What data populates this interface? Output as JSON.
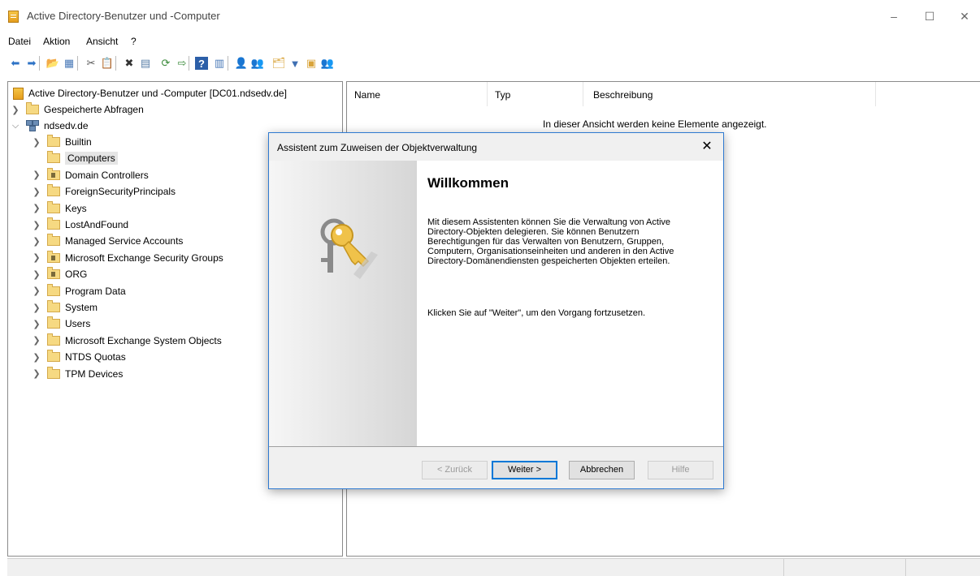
{
  "window": {
    "title": "Active Directory-Benutzer und -Computer",
    "minimize": "–",
    "maximize": "☐",
    "close": "✕"
  },
  "menu": [
    "Datei",
    "Aktion",
    "Ansicht",
    "?"
  ],
  "toolbar": [
    {
      "icon": "back-arrow-icon",
      "glyph": "⬅",
      "color": "#2e73c5"
    },
    {
      "icon": "forward-arrow-icon",
      "glyph": "➡",
      "color": "#2e73c5"
    },
    {
      "icon": "up-folder-icon",
      "glyph": "📂",
      "color": "#d9a43a"
    },
    {
      "icon": "show-console-tree-icon",
      "glyph": "▦",
      "color": "#4a7ab8"
    },
    {
      "icon": "cut-icon",
      "glyph": "✂",
      "color": "#555"
    },
    {
      "icon": "copy-icon",
      "glyph": "📋",
      "color": "#555"
    },
    {
      "icon": "delete-icon",
      "glyph": "✖",
      "color": "#333"
    },
    {
      "icon": "properties-icon",
      "glyph": "▤",
      "color": "#5a7fa8"
    },
    {
      "icon": "refresh-icon",
      "glyph": "⟳",
      "color": "#3a8a3a"
    },
    {
      "icon": "export-list-icon",
      "glyph": "⇨",
      "color": "#3a8a3a"
    },
    {
      "icon": "help-icon",
      "glyph": "?",
      "color": "#fff"
    },
    {
      "icon": "show-action-pane-icon",
      "glyph": "▥",
      "color": "#4a7ab8"
    },
    {
      "icon": "new-user-icon",
      "glyph": "👤",
      "color": "#6b8db5"
    },
    {
      "icon": "new-group-icon",
      "glyph": "👥",
      "color": "#6b8db5"
    },
    {
      "icon": "new-ou-icon",
      "glyph": "🗂",
      "color": "#d9a43a"
    },
    {
      "icon": "filter-icon",
      "glyph": "▼",
      "color": "#3f6fb2"
    },
    {
      "icon": "add-to-group-icon",
      "glyph": "▣",
      "color": "#d9a43a"
    },
    {
      "icon": "delegate-icon",
      "glyph": "👥",
      "color": "#6b8db5"
    }
  ],
  "tree": {
    "root": "Active Directory-Benutzer und -Computer [DC01.ndsedv.de]",
    "saved_queries": "Gespeicherte Abfragen",
    "domain": "ndsedv.de",
    "items": [
      {
        "label": "Builtin",
        "ou": false,
        "selected": false
      },
      {
        "label": "Computers",
        "ou": false,
        "selected": true
      },
      {
        "label": "Domain Controllers",
        "ou": true,
        "selected": false
      },
      {
        "label": "ForeignSecurityPrincipals",
        "ou": false,
        "selected": false
      },
      {
        "label": "Keys",
        "ou": false,
        "selected": false
      },
      {
        "label": "LostAndFound",
        "ou": false,
        "selected": false
      },
      {
        "label": "Managed Service Accounts",
        "ou": false,
        "selected": false
      },
      {
        "label": "Microsoft Exchange Security Groups",
        "ou": true,
        "selected": false
      },
      {
        "label": "ORG",
        "ou": true,
        "selected": false
      },
      {
        "label": "Program Data",
        "ou": false,
        "selected": false
      },
      {
        "label": "System",
        "ou": false,
        "selected": false
      },
      {
        "label": "Users",
        "ou": false,
        "selected": false
      },
      {
        "label": "Microsoft Exchange System Objects",
        "ou": false,
        "selected": false
      },
      {
        "label": "NTDS Quotas",
        "ou": false,
        "selected": false
      },
      {
        "label": "TPM Devices",
        "ou": false,
        "selected": false
      }
    ]
  },
  "list": {
    "columns": [
      "Name",
      "Typ",
      "Beschreibung"
    ],
    "empty_message": "In dieser Ansicht werden keine Elemente angezeigt."
  },
  "dialog": {
    "title": "Assistent zum Zuweisen der Objektverwaltung",
    "heading": "Willkommen",
    "text": "Mit diesem Assistenten können Sie die Verwaltung von Active Directory-Objekten delegieren. Sie können Benutzern Berechtigungen für das Verwalten von Benutzern, Gruppen, Computern, Organisationseinheiten und anderen in den Active Directory-Domänendiensten gespeicherten Objekten erteilen.",
    "text2": "Klicken Sie auf \"Weiter\", um den Vorgang fortzusetzen.",
    "buttons": {
      "back": "< Zurück",
      "next": "Weiter >",
      "cancel": "Abbrechen",
      "help": "Hilfe"
    }
  }
}
